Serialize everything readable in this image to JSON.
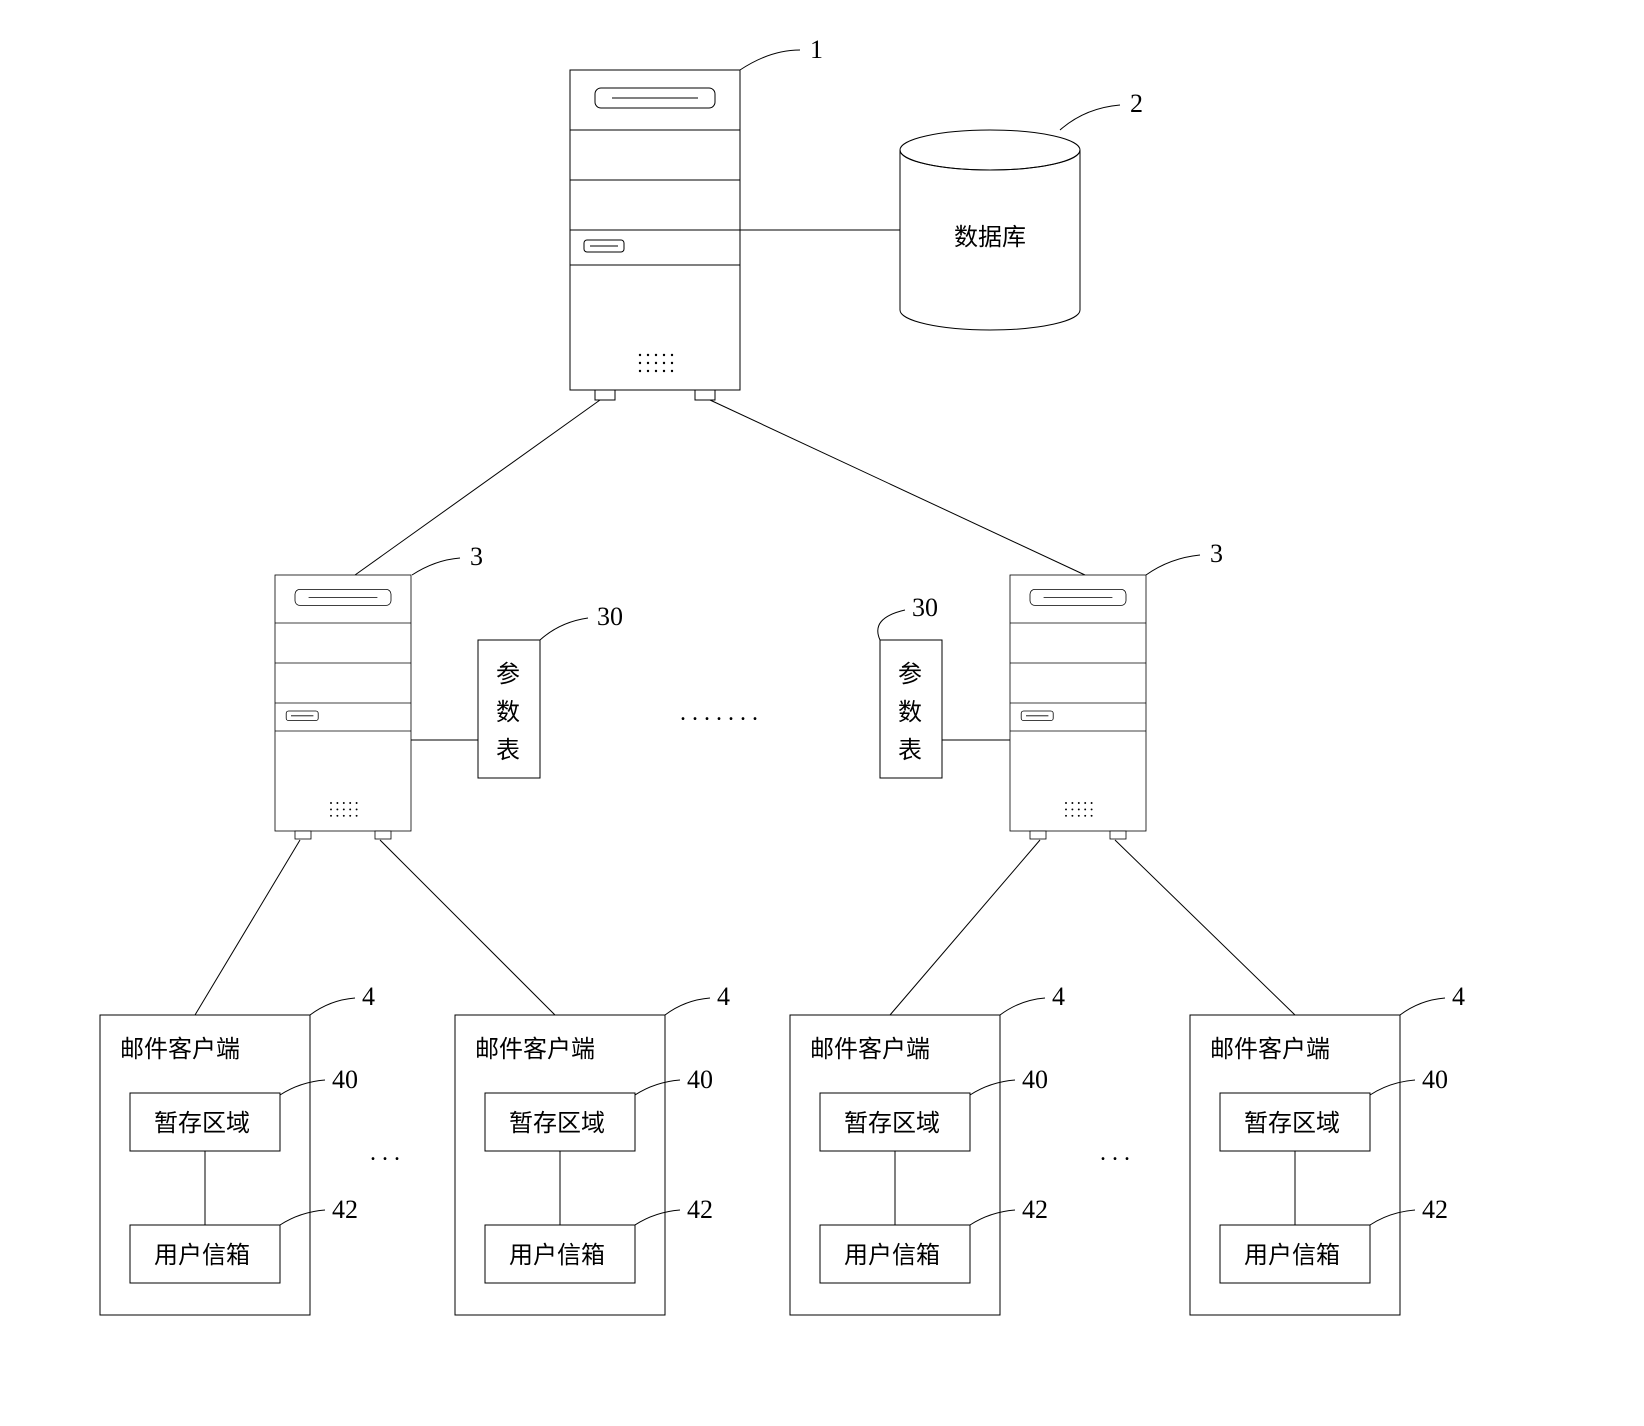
{
  "labels": {
    "main_server": "1",
    "database": "2",
    "database_text": "数据库",
    "sub_server": "3",
    "param_table": "30",
    "param_table_text_1": "参",
    "param_table_text_2": "数",
    "param_table_text_3": "表",
    "mail_client": "4",
    "mail_client_title": "邮件客户端",
    "temp_area": "40",
    "temp_area_text": "暂存区域",
    "user_mailbox": "42",
    "user_mailbox_text": "用户信箱",
    "dots": ". . . . . . .",
    "ellipsis": ". . ."
  }
}
